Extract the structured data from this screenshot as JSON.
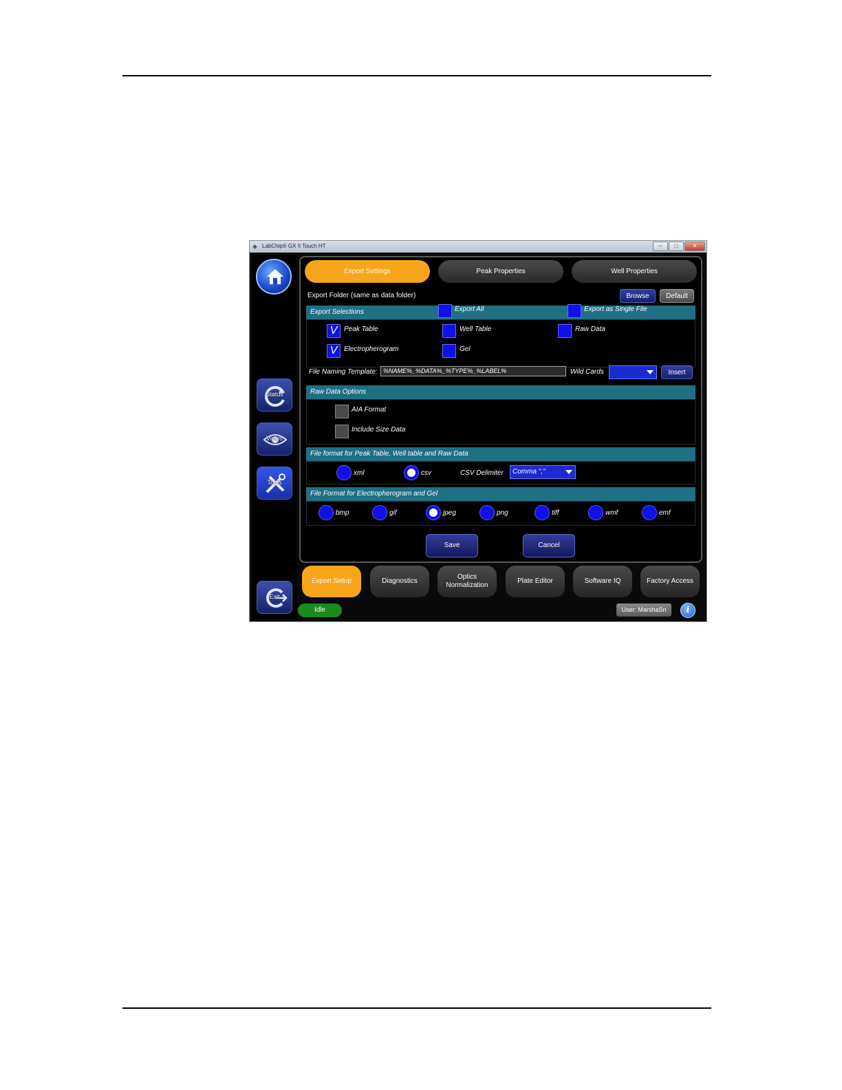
{
  "window": {
    "title": "LabChip® GX II Touch HT",
    "controls": [
      "–",
      "□",
      "✕"
    ]
  },
  "dock": {
    "home_icon": "home-icon",
    "status_label": "Status",
    "views_label": "Views",
    "tools_label": "Tools",
    "exit_label": "Exit"
  },
  "tabs": [
    {
      "label": "Export Settings",
      "active": true
    },
    {
      "label": "Peak Properties",
      "active": false
    },
    {
      "label": "Well Properties",
      "active": false
    }
  ],
  "export_folder": {
    "label": "Export Folder  (same as data folder)",
    "browse_label": "Browse",
    "default_label": "Default"
  },
  "export_selections": {
    "header": "Export Selections",
    "export_all": {
      "label": "Export All",
      "checked": false
    },
    "export_single": {
      "label": "Export as Single File",
      "checked": false
    },
    "items": [
      {
        "label": "Peak Table",
        "checked": true,
        "mark": "V"
      },
      {
        "label": "Well Table",
        "checked": false,
        "mark": ""
      },
      {
        "label": "Raw Data",
        "checked": false,
        "mark": ""
      },
      {
        "label": "Electropherogram",
        "checked": true,
        "mark": "V"
      },
      {
        "label": "Gel",
        "checked": false,
        "mark": ""
      }
    ],
    "template_label": "File Naming Template:",
    "template_value": "%NAME%_%DATA%_%TYPE%_%LABEL%",
    "wildcards_label": "Wild Cards",
    "wildcards_value": "",
    "insert_label": "Insert"
  },
  "raw_data_options": {
    "header": "Raw Data Options",
    "items": [
      {
        "label": "AIA Format",
        "checked": false
      },
      {
        "label": "Include Size Data",
        "checked": false
      }
    ]
  },
  "table_format": {
    "header": "File format for Peak Table, Well table and Raw Data",
    "options": [
      {
        "label": "xml",
        "selected": false
      },
      {
        "label": "csv",
        "selected": true
      }
    ],
    "delimiter_label": "CSV Delimiter",
    "delimiter_value": "Comma \",\""
  },
  "image_format": {
    "header": "File Format for Electropherogram and Gel",
    "options": [
      {
        "label": "bmp",
        "selected": false
      },
      {
        "label": "gif",
        "selected": false
      },
      {
        "label": "jpeg",
        "selected": true
      },
      {
        "label": "png",
        "selected": false
      },
      {
        "label": "tiff",
        "selected": false
      },
      {
        "label": "wmf",
        "selected": false
      },
      {
        "label": "emf",
        "selected": false
      }
    ]
  },
  "actions": {
    "save_label": "Save",
    "cancel_label": "Cancel"
  },
  "bottom_nav": [
    {
      "label": "Export Setup",
      "active": true
    },
    {
      "label": "Diagnostics",
      "active": false
    },
    {
      "label": "Optics Normalization",
      "active": false
    },
    {
      "label": "Plate Editor",
      "active": false
    },
    {
      "label": "Software IQ",
      "active": false
    },
    {
      "label": "Factory Access",
      "active": false
    }
  ],
  "status": {
    "state": "Idle",
    "user": "User: MarshaSn",
    "info_glyph": "i"
  },
  "colors": {
    "accent_orange": "#f7a61b",
    "checkbox_blue": "#1010e8",
    "section_teal": "#1f6f85",
    "idle_green": "#1c8a1c"
  }
}
